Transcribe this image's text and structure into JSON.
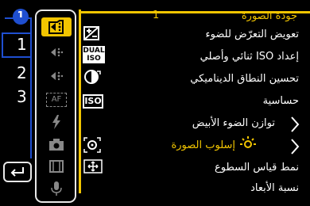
{
  "menu_group": {
    "badge": "1",
    "pages": [
      "1",
      "2",
      "3"
    ],
    "selected_page": "1"
  },
  "header": {
    "number": "1",
    "title": "جودة الصورة"
  },
  "menu_items": [
    {
      "label": "تعويض التعرّض للضوء"
    },
    {
      "label": "إعداد ISO ثنائي وأصلي"
    },
    {
      "label": "تحسين النطاق الديناميكي"
    },
    {
      "label": "حساسية"
    },
    {
      "label": "توازن الضوء الأبيض"
    },
    {
      "label": "إسلوب الصورة"
    },
    {
      "label": "نمط قياس السطوع"
    },
    {
      "label": "نسبة الأبعاد"
    }
  ],
  "side_icons": {
    "dual_iso_line1": "DUAL",
    "dual_iso_line2": "ISO",
    "iso": "ISO",
    "af": "AF"
  },
  "colors": {
    "accent": "#f2c500",
    "blue": "#1f4fd1",
    "background": "#000000"
  }
}
